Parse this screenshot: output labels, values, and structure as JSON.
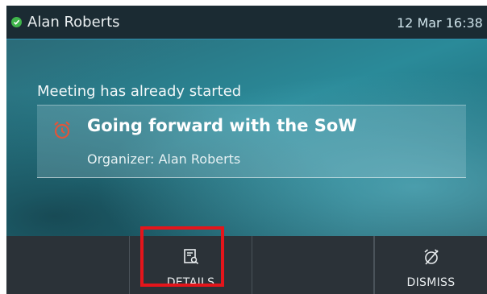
{
  "status_bar": {
    "user_name": "Alan Roberts",
    "datetime": "12 Mar 16:38",
    "presence_icon": "check-circle-icon",
    "presence_color": "#3fb54b"
  },
  "notification": {
    "headline": "Meeting has already started",
    "meeting_title": "Going forward with the SoW",
    "organizer": "Organizer: Alan Roberts",
    "icon": "alarm-clock-icon",
    "icon_color": "#e0553a"
  },
  "softkeys": [
    {
      "label": ""
    },
    {
      "label": "DETAILS",
      "icon": "details-icon"
    },
    {
      "label": ""
    },
    {
      "label": "DISMISS",
      "icon": "dismiss-alarm-icon"
    }
  ],
  "highlight_color": "#e4151b"
}
